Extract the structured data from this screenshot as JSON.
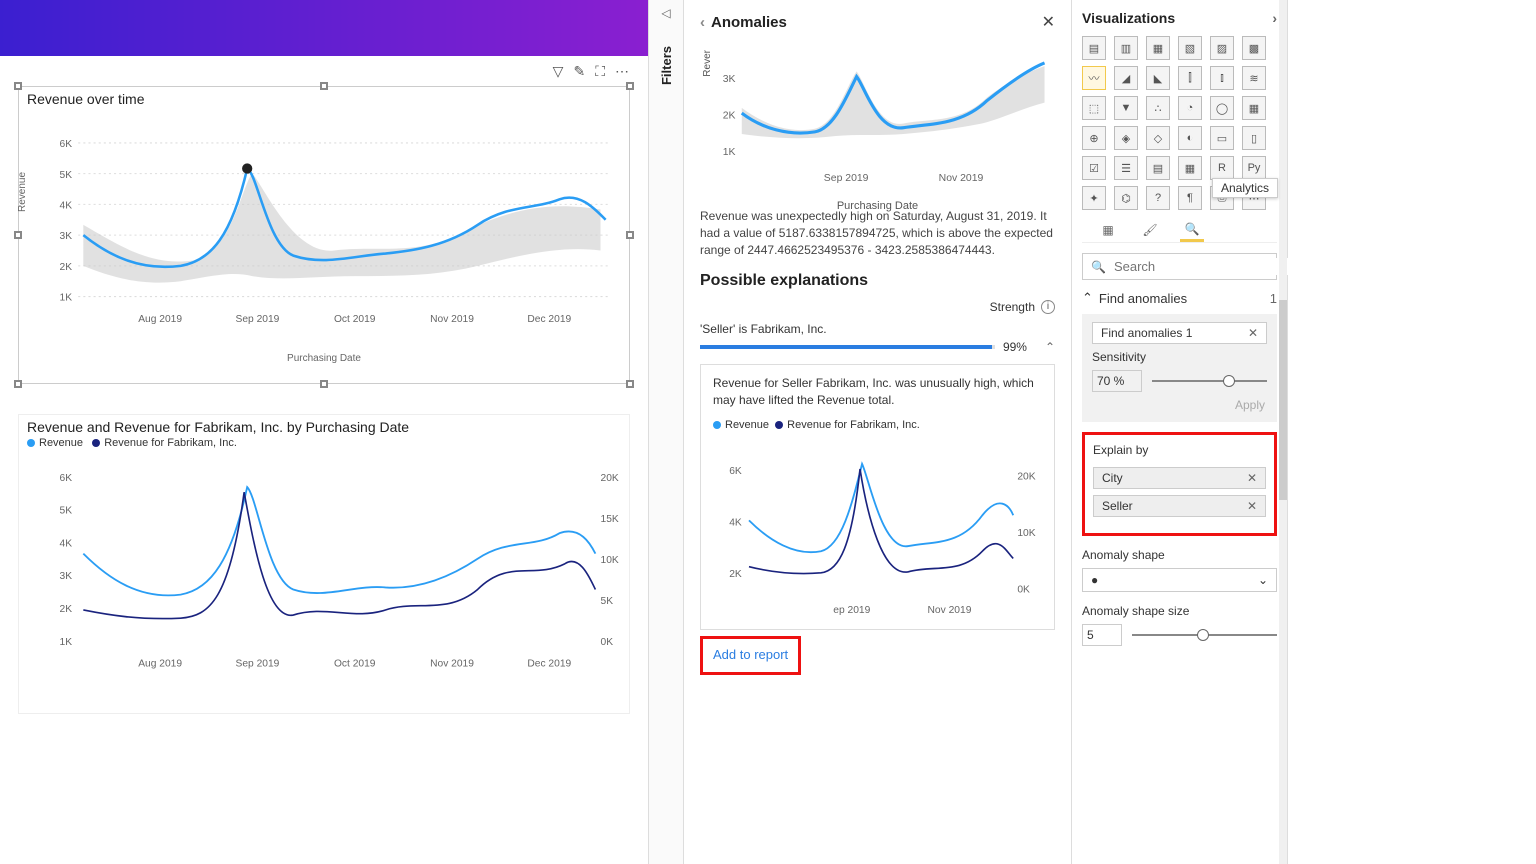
{
  "canvas": {
    "chart1": {
      "title": "Revenue over time",
      "ylabel": "Revenue",
      "xlabel": "Purchasing Date",
      "yticks": [
        "1K",
        "2K",
        "3K",
        "4K",
        "5K",
        "6K"
      ],
      "xticks": [
        "Aug 2019",
        "Sep 2019",
        "Oct 2019",
        "Nov 2019",
        "Dec 2019"
      ]
    },
    "chart2": {
      "title": "Revenue and Revenue for Fabrikam, Inc. by Purchasing Date",
      "legend1": "Revenue",
      "legend2": "Revenue for Fabrikam, Inc.",
      "yticks_left": [
        "1K",
        "2K",
        "3K",
        "4K",
        "5K",
        "6K"
      ],
      "yticks_right": [
        "0K",
        "5K",
        "10K",
        "15K",
        "20K"
      ],
      "xticks": [
        "Aug 2019",
        "Sep 2019",
        "Oct 2019",
        "Nov 2019",
        "Dec 2019"
      ]
    },
    "toolbar": {
      "filter": "▽",
      "edit": "✎",
      "focus": "⛶",
      "more": "⋯"
    }
  },
  "filters": {
    "label": "Filters"
  },
  "anomalies": {
    "title": "Anomalies",
    "mini_ylabel": "Rever",
    "mini_yticks": [
      "1K",
      "2K",
      "3K"
    ],
    "mini_xticks": [
      "Sep 2019",
      "Nov 2019"
    ],
    "mini_xlabel": "Purchasing Date",
    "description": "Revenue was unexpectedly high on Saturday, August 31, 2019. It had a value of 5187.6338157894725, which is above the expected range of 2447.4662523495376 - 3423.2585386474443.",
    "section": "Possible explanations",
    "strength_label": "Strength",
    "item1": "'Seller' is Fabrikam, Inc.",
    "item1_pct": "99%",
    "card_text": "Revenue for Seller Fabrikam, Inc. was unusually high, which may have lifted the Revenue total.",
    "card_legend1": "Revenue",
    "card_legend2": "Revenue for Fabrikam, Inc.",
    "card_yticks_left": [
      "2K",
      "4K",
      "6K"
    ],
    "card_yticks_right": [
      "0K",
      "10K",
      "20K"
    ],
    "card_xticks": [
      "ep 2019",
      "Nov 2019"
    ],
    "add_report": "Add to report"
  },
  "viz": {
    "title": "Visualizations",
    "tooltip": "Analytics",
    "search_ph": "Search",
    "find_label": "Find anomalies",
    "find_count": "1",
    "instance": "Find anomalies 1",
    "sensitivity": "Sensitivity",
    "sens_val": "70  %",
    "apply": "Apply",
    "explain": "Explain by",
    "field1": "City",
    "field2": "Seller",
    "shape": "Anomaly shape",
    "shape_val": "●",
    "size": "Anomaly shape size",
    "size_val": "5"
  },
  "chart_data": [
    {
      "type": "line",
      "title": "Revenue over time",
      "xlabel": "Purchasing Date",
      "ylabel": "Revenue",
      "ylim": [
        0,
        6000
      ],
      "x": [
        "2019-07",
        "2019-08",
        "2019-09",
        "2019-10",
        "2019-11",
        "2019-12"
      ],
      "series": [
        {
          "name": "Revenue",
          "values": [
            3500,
            2600,
            5200,
            2700,
            2800,
            3600
          ]
        }
      ],
      "anomaly": {
        "x": "2019-08-31",
        "value": 5187.63,
        "expected_range": [
          2447.47,
          3423.26
        ]
      }
    },
    {
      "type": "line",
      "title": "Revenue and Revenue for Fabrikam, Inc. by Purchasing Date",
      "xlabel": "Purchasing Date",
      "ylim_left": [
        0,
        6000
      ],
      "ylim_right": [
        0,
        20000
      ],
      "x": [
        "2019-07",
        "2019-08",
        "2019-09",
        "2019-10",
        "2019-11",
        "2019-12"
      ],
      "series": [
        {
          "name": "Revenue",
          "axis": "left",
          "values": [
            3500,
            2600,
            5200,
            2700,
            2800,
            3600
          ]
        },
        {
          "name": "Revenue for Fabrikam, Inc.",
          "axis": "right",
          "values": [
            6000,
            5000,
            18000,
            4000,
            6000,
            9000
          ]
        }
      ]
    }
  ]
}
